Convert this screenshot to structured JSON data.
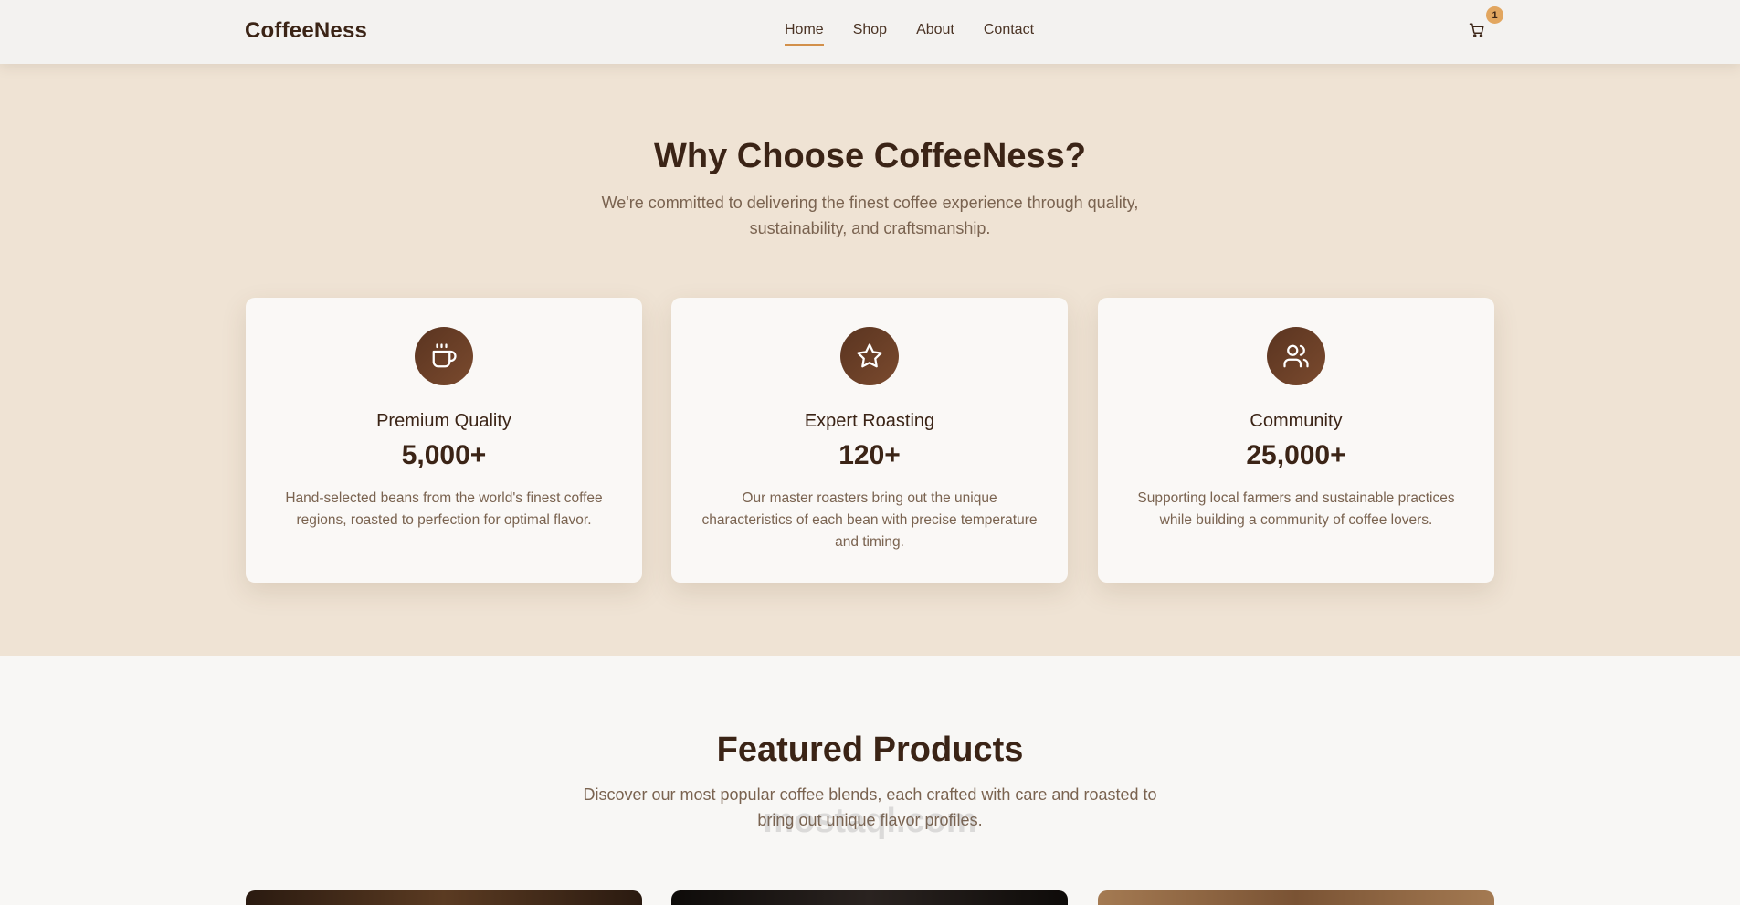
{
  "brand": "CoffeeNess",
  "nav": {
    "items": [
      {
        "label": "Home",
        "active": true
      },
      {
        "label": "Shop",
        "active": false
      },
      {
        "label": "About",
        "active": false
      },
      {
        "label": "Contact",
        "active": false
      }
    ],
    "cart_icon": "shopping-cart-icon",
    "cart_count": "1"
  },
  "why": {
    "title": "Why Choose CoffeeNess?",
    "subtitle": "We're committed to delivering the finest coffee experience through quality, sustainability, and craftsmanship.",
    "cards": [
      {
        "icon": "coffee-cup-icon",
        "title": "Premium Quality",
        "stat": "5,000+",
        "description": "Hand-selected beans from the world's finest coffee regions, roasted to perfection for optimal flavor."
      },
      {
        "icon": "star-icon",
        "title": "Expert Roasting",
        "stat": "120+",
        "description": "Our master roasters bring out the unique characteristics of each bean with precise temperature and timing."
      },
      {
        "icon": "users-icon",
        "title": "Community",
        "stat": "25,000+",
        "description": "Supporting local farmers and sustainable practices while building a community of coffee lovers."
      }
    ]
  },
  "featured": {
    "title": "Featured Products",
    "subtitle": "Discover our most popular coffee blends, each crafted with care and roasted to bring out unique flavor profiles."
  },
  "watermark": "mostaql.com",
  "colors": {
    "accent": "#d2904a",
    "badge": "#e2a65f",
    "icon_circle": "#5a3420",
    "section_bg": "#efe3d4",
    "text_dark": "#3b2416"
  }
}
